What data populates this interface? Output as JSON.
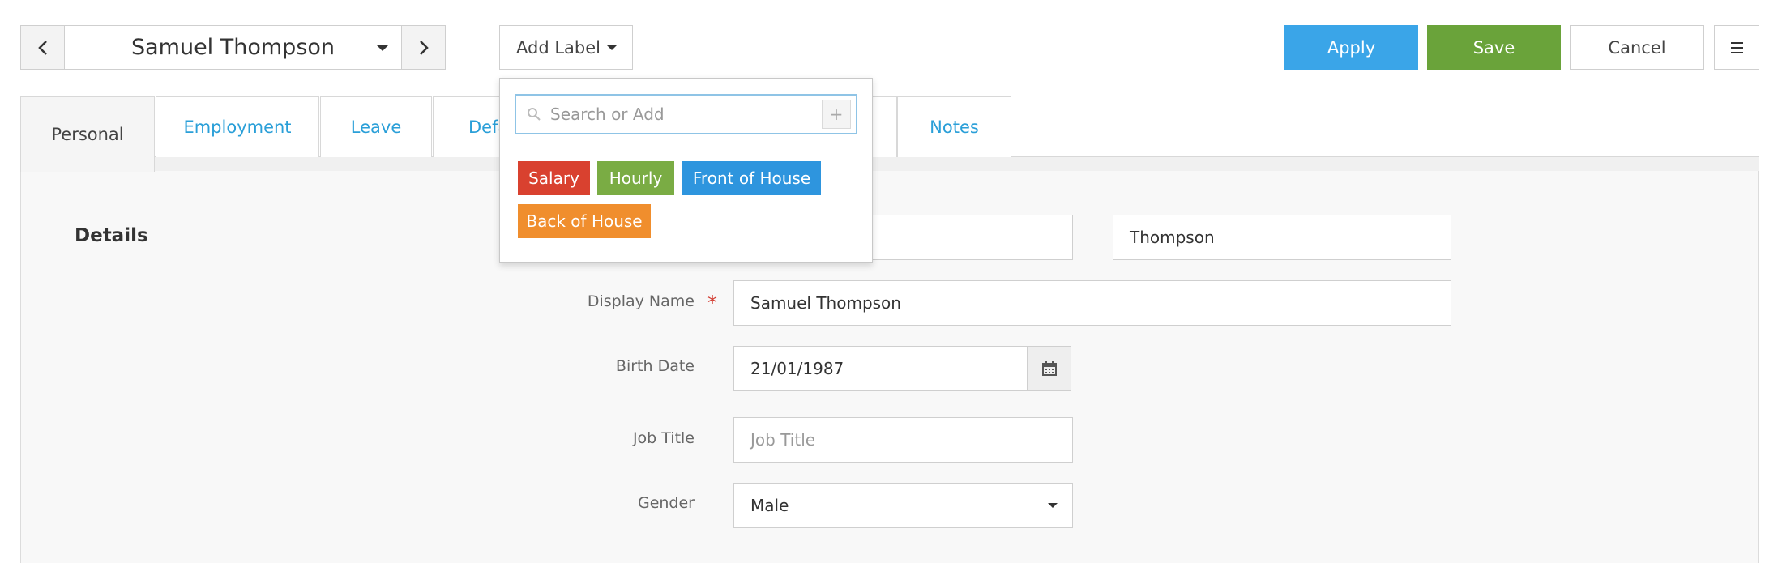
{
  "navigator": {
    "employee_name": "Samuel Thompson"
  },
  "toolbar": {
    "add_label": "Add Label",
    "apply_label": "Apply",
    "save_label": "Save",
    "cancel_label": "Cancel"
  },
  "tabs": [
    {
      "label": "Personal",
      "active": true
    },
    {
      "label": "Employment",
      "active": false
    },
    {
      "label": "Leave",
      "active": false
    },
    {
      "label": "Defa",
      "active": false
    },
    {
      "label": "Notes",
      "active": false
    }
  ],
  "details": {
    "section_title": "Details",
    "last_name_value": "Thompson",
    "display_name_label": "Display Name",
    "required_mark": "*",
    "display_name_value": "Samuel Thompson",
    "birth_date_label": "Birth Date",
    "birth_date_value": "21/01/1987",
    "job_title_label": "Job Title",
    "job_title_placeholder": "Job Title",
    "gender_label": "Gender",
    "gender_value": "Male"
  },
  "label_dropdown": {
    "search_placeholder": "Search or Add",
    "plus": "+",
    "labels": [
      {
        "text": "Salary",
        "color": "#d9412f"
      },
      {
        "text": "Hourly",
        "color": "#7aac44"
      },
      {
        "text": "Front of House",
        "color": "#2e95de"
      },
      {
        "text": "Back of House",
        "color": "#f08e2d"
      }
    ]
  },
  "colors": {
    "apply": "#3aa5e8",
    "save": "#6aa33a",
    "link": "#2a9fd8",
    "required": "#d23b30"
  }
}
